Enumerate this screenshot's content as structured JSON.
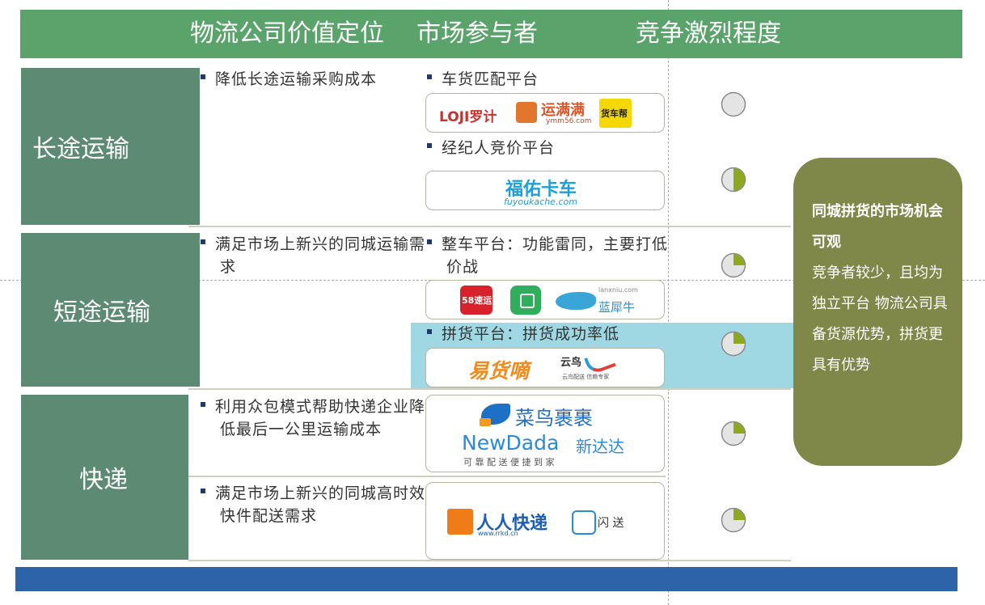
{
  "header": {
    "col1": "物流公司价值定位",
    "col2": "市场参与者",
    "col3": "竞争激烈程度"
  },
  "rows": {
    "long": {
      "label": "长途运输",
      "value_prop": "降低长途运输采购成本",
      "participant_1": "车货匹配平台",
      "participant_2": "经纪人竞价平台",
      "gauge_1": 0,
      "gauge_2": 0.5
    },
    "short": {
      "label": "短途运输",
      "value_prop": "满足市场上新兴的同城运输需求",
      "participant_1": "整车平台：功能雷同，主要打低价战",
      "participant_2": "拼货平台：拼货成功率低",
      "gauge_1": 0.25,
      "gauge_2": 0.25
    },
    "express": {
      "label": "快递",
      "value_prop_1": "利用众包模式帮助快递企业降低最后一公里运输成本",
      "value_prop_2": "满足市场上新兴的同城高时效快件配送需求",
      "gauge_1": 0.25,
      "gauge_2": 0.25
    }
  },
  "logos": {
    "loji": "LOJI罗计",
    "yunmanman": "运满满",
    "yunmanman_sub": "ymm56.com",
    "huochebang": "货车帮",
    "fuyou": "福佑卡车",
    "fuyou_sub": "fuyoukache.com",
    "wuba": "58速运",
    "lanxiniu": "蓝犀牛",
    "lanxiniu_sub": "lanxniu.com",
    "yihuodi": "易货嘀",
    "yunniao": "云鸟",
    "yunniao_sub": "云鸟配送 信赖专家",
    "cainiao": "菜鸟裹裹",
    "newdada": "NewDada",
    "newdada_cn": "新达达",
    "newdada_slogan": "可 靠 配 送 便 捷 到 家",
    "renren": "人人快递",
    "renren_sub": "www.rrkd.cn",
    "shansong": "闪 送"
  },
  "callout": {
    "title": "同城拼货的市场机会可观",
    "body": "竞争者较少，且均为独立平台 物流公司具备货源优势，拼货更具有优势"
  },
  "colors": {
    "header_green": "#5aa46b",
    "label_green": "#5d8a73",
    "callout_olive": "#7f8749",
    "highlight_blue": "#9fd8e3",
    "footer_blue": "#2d63a8",
    "gauge_fill": "#8ea820"
  }
}
